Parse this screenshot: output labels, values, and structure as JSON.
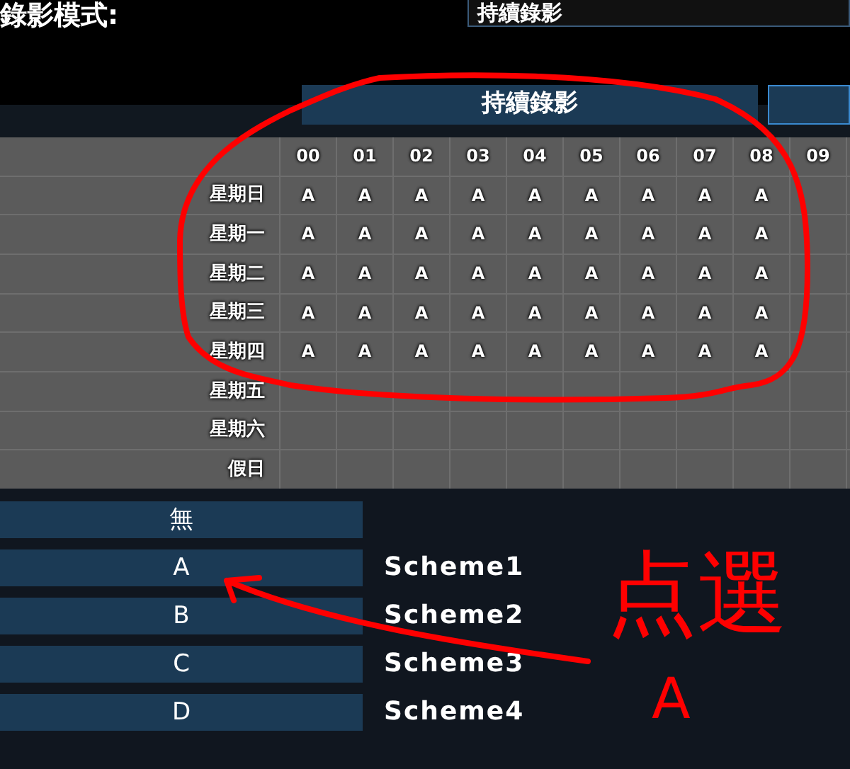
{
  "record_mode": {
    "label": "錄影模式:",
    "value": "持續錄影"
  },
  "mode_tabs": [
    {
      "label": "持續錄影",
      "selected": false
    },
    {
      "selected": true
    }
  ],
  "schedule": {
    "hours": [
      "00",
      "01",
      "02",
      "03",
      "04",
      "05",
      "06",
      "07",
      "08",
      "09"
    ],
    "rows": [
      {
        "day": "星期日",
        "cells": [
          "A",
          "A",
          "A",
          "A",
          "A",
          "A",
          "A",
          "A",
          "A"
        ]
      },
      {
        "day": "星期一",
        "cells": [
          "A",
          "A",
          "A",
          "A",
          "A",
          "A",
          "A",
          "A",
          "A"
        ]
      },
      {
        "day": "星期二",
        "cells": [
          "A",
          "A",
          "A",
          "A",
          "A",
          "A",
          "A",
          "A",
          "A"
        ]
      },
      {
        "day": "星期三",
        "cells": [
          "A",
          "A",
          "A",
          "A",
          "A",
          "A",
          "A",
          "A",
          "A"
        ]
      },
      {
        "day": "星期四",
        "cells": [
          "A",
          "A",
          "A",
          "A",
          "A",
          "A",
          "A",
          "A",
          "A"
        ]
      },
      {
        "day": "星期五",
        "cells": []
      },
      {
        "day": "星期六",
        "cells": []
      },
      {
        "day": "假日",
        "cells": []
      }
    ]
  },
  "schemes": [
    {
      "button": "無"
    },
    {
      "button": "A",
      "name": "Scheme1"
    },
    {
      "button": "B",
      "name": "Scheme2"
    },
    {
      "button": "C",
      "name": "Scheme3"
    },
    {
      "button": "D",
      "name": "Scheme4"
    }
  ],
  "annotations": [
    {
      "text": "点選"
    },
    {
      "text": "A"
    }
  ]
}
